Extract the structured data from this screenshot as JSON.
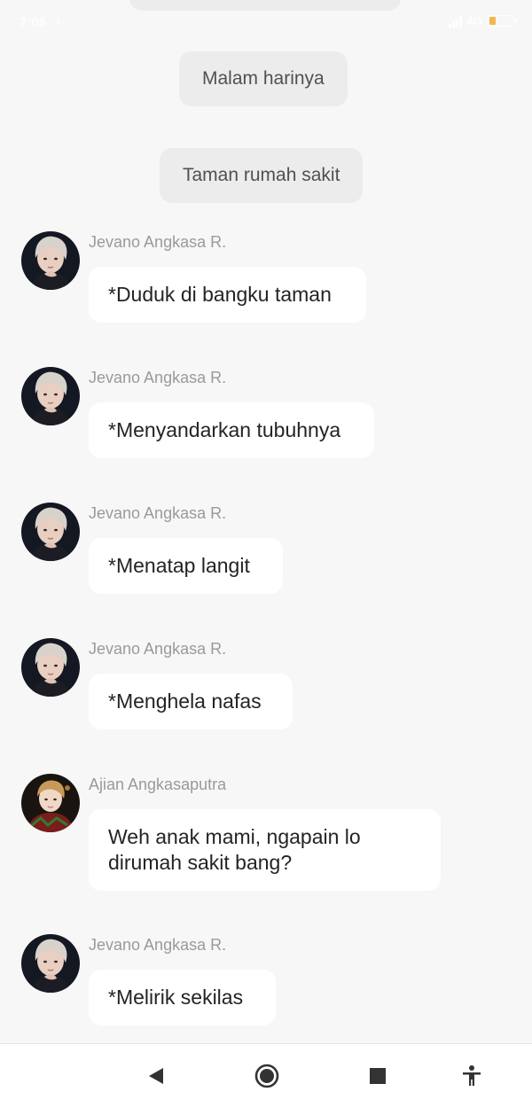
{
  "status_bar": {
    "time": "7:06",
    "network": "4G",
    "icons": [
      "music-note-icon",
      "more-dots-icon",
      "signal-icon",
      "battery-icon"
    ],
    "battery_color": "#f2b13b"
  },
  "narrations": [
    "Malam harinya",
    "Taman rumah sakit"
  ],
  "messages": [
    {
      "sender": "Jevano Angkasa R.",
      "text": "*Duduk di bangku taman",
      "avatar": "jevano-avatar"
    },
    {
      "sender": "Jevano Angkasa R.",
      "text": "*Menyandarkan tubuhnya",
      "avatar": "jevano-avatar"
    },
    {
      "sender": "Jevano Angkasa R.",
      "text": "*Menatap langit",
      "avatar": "jevano-avatar"
    },
    {
      "sender": "Jevano Angkasa R.",
      "text": "*Menghela nafas",
      "avatar": "jevano-avatar"
    },
    {
      "sender": "Ajian Angkasaputra",
      "text": "Weh anak mami, ngapain lo dirumah sakit bang?",
      "avatar": "ajian-avatar"
    },
    {
      "sender": "Jevano Angkasa R.",
      "text": "*Melirik sekilas",
      "avatar": "jevano-avatar"
    }
  ],
  "nav_bar": {
    "buttons": [
      "back-icon",
      "home-icon",
      "recents-icon",
      "accessibility-icon"
    ]
  }
}
